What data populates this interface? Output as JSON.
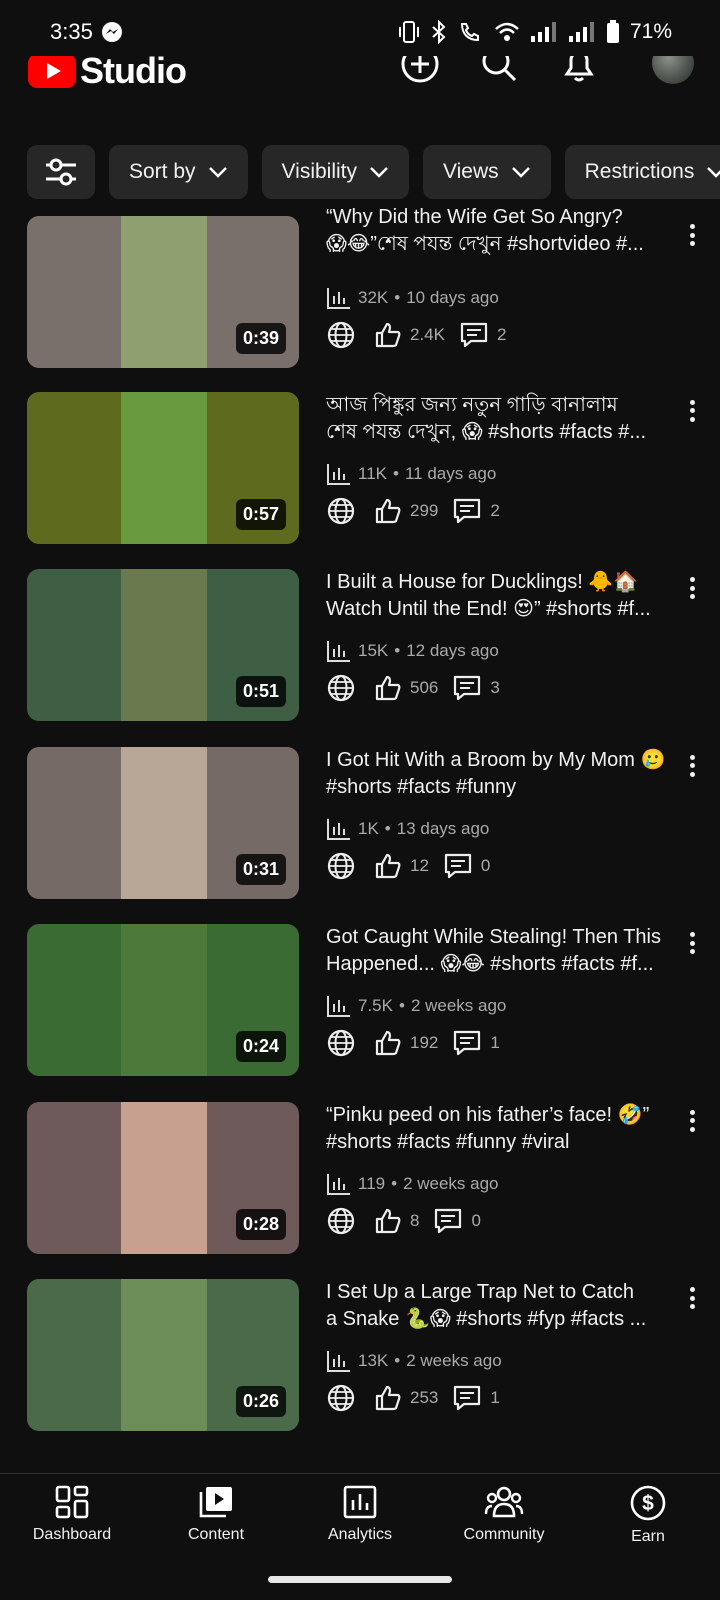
{
  "status": {
    "time": "3:35",
    "battery": "71%"
  },
  "header": {
    "logo_text": "Studio",
    "brand_color": "#ff0000"
  },
  "filters": [
    {
      "label": "Sort by"
    },
    {
      "label": "Visibility"
    },
    {
      "label": "Views"
    },
    {
      "label": "Restrictions"
    }
  ],
  "videos": [
    {
      "title_line1": "“Why Did the Wife Get So Angry?",
      "title_line2": "😱😂”শেষ পযন্ত দেখুন #shortvideo #...",
      "duration": "0:39",
      "views": "32K",
      "age": "10 days ago",
      "likes": "2.4K",
      "comments": "2",
      "thumb_bg": "#7a706b",
      "thumb_fg": "#8fa070"
    },
    {
      "title_line1": "আজ পিঙ্কুর জন্য নতুন গাড়ি বানালাম",
      "title_line2": "শেষ পযন্ত দেখুন, 😱 #shorts #facts #...",
      "duration": "0:57",
      "views": "11K",
      "age": "11 days ago",
      "likes": "299",
      "comments": "2",
      "thumb_bg": "#5e6a1e",
      "thumb_fg": "#6a9a40"
    },
    {
      "title_line1": "I Built a House for Ducklings! 🐥🏠",
      "title_line2": "Watch Until the End! 😍” #shorts #f...",
      "duration": "0:51",
      "views": "15K",
      "age": "12 days ago",
      "likes": "506",
      "comments": "3",
      "thumb_bg": "#3f5f45",
      "thumb_fg": "#6b7a4e"
    },
    {
      "title_line1": "I Got Hit With a Broom by My Mom 🥲",
      "title_line2": "#shorts #facts #funny",
      "duration": "0:31",
      "views": "1K",
      "age": "13 days ago",
      "likes": "12",
      "comments": "0",
      "thumb_bg": "#756a66",
      "thumb_fg": "#b8a696"
    },
    {
      "title_line1": "Got Caught While Stealing! Then This",
      "title_line2": "Happened... 😱😂 #shorts #facts #f...",
      "duration": "0:24",
      "views": "7.5K",
      "age": "2 weeks ago",
      "likes": "192",
      "comments": "1",
      "thumb_bg": "#3a6b32",
      "thumb_fg": "#4d7a3a"
    },
    {
      "title_line1": "“Pinku peed on his father’s face! 🤣”",
      "title_line2": "#shorts #facts #funny #viral",
      "duration": "0:28",
      "views": "119",
      "age": "2 weeks ago",
      "likes": "8",
      "comments": "0",
      "thumb_bg": "#6e5a5a",
      "thumb_fg": "#c8a090"
    },
    {
      "title_line1": "I Set Up a Large Trap Net to Catch",
      "title_line2": "a Snake 🐍😱 #shorts #fyp #facts ...",
      "duration": "0:26",
      "views": "13K",
      "age": "2 weeks ago",
      "likes": "253",
      "comments": "1",
      "thumb_bg": "#4a6a4a",
      "thumb_fg": "#6d8e58"
    }
  ],
  "nav": [
    {
      "label": "Dashboard"
    },
    {
      "label": "Content"
    },
    {
      "label": "Analytics"
    },
    {
      "label": "Community"
    },
    {
      "label": "Earn"
    }
  ]
}
